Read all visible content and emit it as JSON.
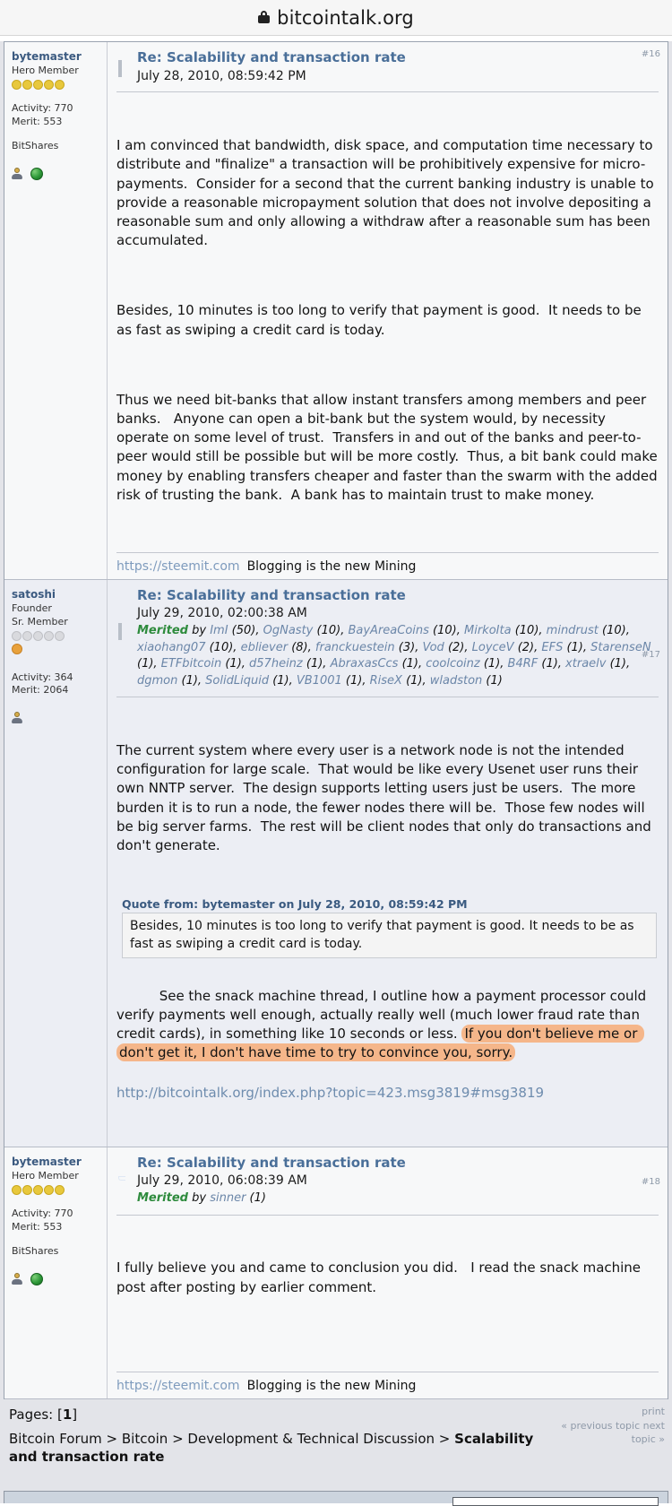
{
  "browser": {
    "lock_icon": "lock-icon",
    "url": "bitcointalk.org"
  },
  "posts": [
    {
      "msgnum": "#16",
      "icon": "diamond-icon",
      "author": {
        "name": "bytemaster",
        "rank": "Hero Member",
        "stars": 5,
        "stars_filled": 5,
        "activity_label": "Activity: 770",
        "merit_label": "Merit: 553",
        "blurb": "BitShares",
        "icons": [
          "profile-icon",
          "globe-icon"
        ]
      },
      "subject": "Re: Scalability and transaction rate",
      "date": "July 28, 2010, 08:59:42 PM",
      "paragraphs": [
        "I am convinced that bandwidth, disk space, and computation time necessary to distribute and \"finalize\" a transaction will be prohibitively expensive for micro-payments.  Consider for a second that the current banking industry is unable to provide a reasonable micropayment solution that does not involve depositing a reasonable sum and only allowing a withdraw after a reasonable sum has been accumulated.",
        "Besides, 10 minutes is too long to verify that payment is good.  It needs to be as fast as swiping a credit card is today.",
        "Thus we need bit-banks that allow instant transfers among members and peer banks.   Anyone can open a bit-bank but the system would, by necessity operate on some level of trust.  Transfers in and out of the banks and peer-to-peer would still be possible but will be more costly.  Thus, a bit bank could make money by enabling transfers cheaper and faster than the swarm with the added risk of trusting the bank.  A bank has to maintain trust to make money."
      ],
      "signature_link": "https://steemit.com",
      "signature_text": "Blogging is the new Mining"
    },
    {
      "msgnum": "#17",
      "icon": "diamond-icon",
      "author": {
        "name": "satoshi",
        "rank": "Founder",
        "rank2": "Sr. Member",
        "stars": 5,
        "stars_filled": 0,
        "badge": "orange-badge",
        "activity_label": "Activity: 364",
        "merit_label": "Merit: 2064",
        "icons": [
          "profile-icon"
        ]
      },
      "subject": "Re: Scalability and transaction rate",
      "date": "July 29, 2010, 02:00:38 AM",
      "merited_word": "Merited",
      "merited_by": "by",
      "meriters": [
        {
          "name": "ImI",
          "count": "(50)"
        },
        {
          "name": "OgNasty",
          "count": "(10)"
        },
        {
          "name": "BayAreaCoins",
          "count": "(10)"
        },
        {
          "name": "MirkoIta",
          "count": "(10)"
        },
        {
          "name": "mindrust",
          "count": "(10)"
        },
        {
          "name": "xiaohang07",
          "count": "(10)"
        },
        {
          "name": "ebliever",
          "count": "(8)"
        },
        {
          "name": "franckuestein",
          "count": "(3)"
        },
        {
          "name": "Vod",
          "count": "(2)"
        },
        {
          "name": "LoyceV",
          "count": "(2)"
        },
        {
          "name": "EFS",
          "count": "(1)"
        },
        {
          "name": "StarenseN",
          "count": "(1)"
        },
        {
          "name": "ETFbitcoin",
          "count": "(1)"
        },
        {
          "name": "d57heinz",
          "count": "(1)"
        },
        {
          "name": "AbraxasCcs",
          "count": "(1)"
        },
        {
          "name": "coolcoinz",
          "count": "(1)"
        },
        {
          "name": "B4RF",
          "count": "(1)"
        },
        {
          "name": "xtraelv",
          "count": "(1)"
        },
        {
          "name": "dgmon",
          "count": "(1)"
        },
        {
          "name": "SolidLiquid",
          "count": "(1)"
        },
        {
          "name": "VB1001",
          "count": "(1)"
        },
        {
          "name": "RiseX",
          "count": "(1)"
        },
        {
          "name": "wladston",
          "count": "(1)"
        }
      ],
      "paragraph1": "The current system where every user is a network node is not the intended configuration for large scale.  That would be like every Usenet user runs their own NNTP server.  The design supports letting users just be users.  The more burden it is to run a node, the fewer nodes there will be.  Those few nodes will be big server farms.  The rest will be client nodes that only do transactions and don't generate.",
      "quote_header": "Quote from: bytemaster on July 28, 2010, 08:59:42 PM",
      "quote_body": "Besides, 10 minutes is too long to verify that payment is good.  It needs to be as fast as swiping a credit card is today.",
      "para2_plain": "See the snack machine thread, I outline how a payment processor could verify payments well enough, actually really well (much lower fraud rate than credit cards), in something like 10 seconds or less. ",
      "para2_highlight": "If you don't believe me or don't get it, I don't have time to try to convince you, sorry.",
      "link_url": "http://bitcointalk.org/index.php?topic=423.msg3819#msg3819"
    },
    {
      "msgnum": "#18",
      "icon": "reply-icon",
      "author": {
        "name": "bytemaster",
        "rank": "Hero Member",
        "stars": 5,
        "stars_filled": 5,
        "activity_label": "Activity: 770",
        "merit_label": "Merit: 553",
        "blurb": "BitShares",
        "icons": [
          "profile-icon",
          "globe-icon"
        ]
      },
      "subject": "Re: Scalability and transaction rate",
      "date": "July 29, 2010, 06:08:39 AM",
      "merited_word": "Merited",
      "merited_by": "by",
      "meriters": [
        {
          "name": "sinner",
          "count": "(1)"
        }
      ],
      "paragraph1": "I fully believe you and came to conclusion you did.   I read the snack machine post after posting by earlier comment.",
      "signature_link": "https://steemit.com",
      "signature_text": "Blogging is the new Mining"
    }
  ],
  "footer": {
    "pages_label": "Pages: [",
    "pages_current": "1",
    "pages_close": "]",
    "print_label": "print",
    "prev_next": "« previous topic next topic »",
    "breadcrumb_prefix": "Bitcoin Forum > Bitcoin > Development & Technical Discussion > ",
    "breadcrumb_current": "Scalability and transaction rate"
  },
  "colors": {
    "subject_blue": "#4a6f99",
    "merit_green": "#2e8b3d",
    "username_blue": "#6b86a8",
    "highlight_orange": "#f5b68a",
    "page_bg": "#e3e4e9",
    "post_odd_bg": "#f7f8f9",
    "post_even_bg": "#eceef4"
  }
}
